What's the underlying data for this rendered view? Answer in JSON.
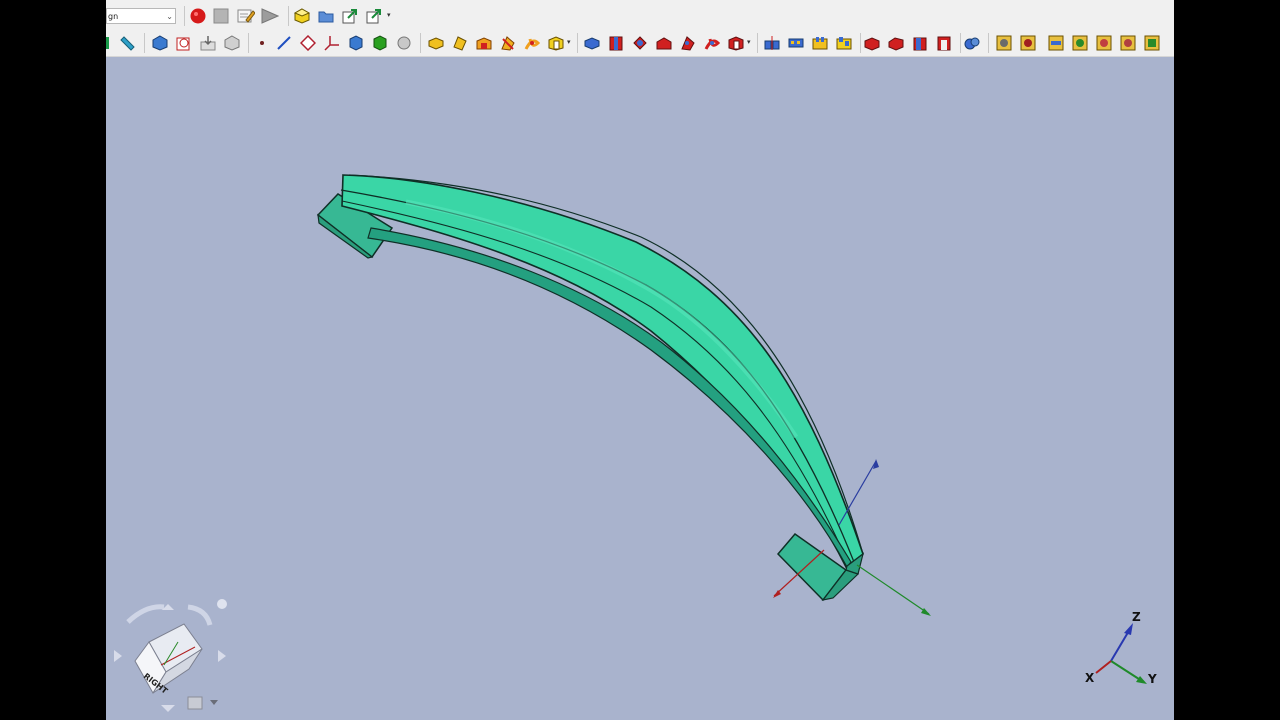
{
  "workbench_combo": {
    "value": "gn"
  },
  "macro_toolbar": [
    "record-macro-icon",
    "stop-macro-icon",
    "edit-macro-icon",
    "execute-macro-icon"
  ],
  "view": {
    "navigation_cube_face": "RIGHT"
  },
  "axis_labels": {
    "x": "X",
    "y": "Y",
    "z": "Z"
  },
  "colors": {
    "background": "#a9b3cd",
    "part_fill": "#3cd2a2",
    "part_edge": "#0f2f26"
  }
}
